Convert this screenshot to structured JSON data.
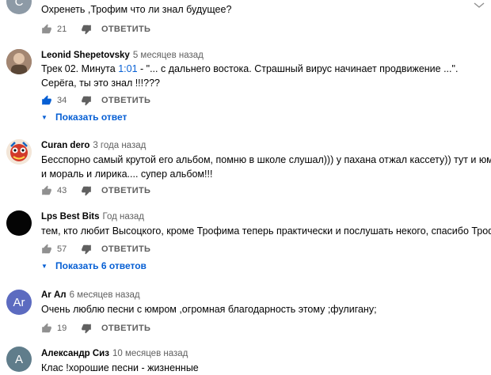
{
  "comments": [
    {
      "avatar_letter": "С",
      "avatar_color": "#8d9aa6",
      "author": "",
      "time": "",
      "lines": [
        "Охренеть ,Трофим что ли знал будущее?"
      ],
      "likes": "21",
      "reply_label": "ОТВЕТИТЬ"
    },
    {
      "avatar_color": "#8b6d5a",
      "author": "Leonid Shepetovsky",
      "time": "5 месяцев назад",
      "line1_prefix": "Трек 02. Минута ",
      "line1_link": "1:01",
      "line1_suffix": " - \"... с дальнего востока. Страшный вирус начинает продвижение ...\".",
      "line2": "Серёга, ты это знал !!!???",
      "likes": "34",
      "reply_label": "ОТВЕТИТЬ",
      "show_replies": "Показать ответ"
    },
    {
      "avatar_color": "#c0392b",
      "author": "Curan dero",
      "time": "3 года назад",
      "lines": [
        "Бесспорно самый крутой его альбом, помню в школе слушал))) у пахана отжал кассету)) тут и юмор",
        "и мораль и лирика.... супер альбом!!!"
      ],
      "likes": "43",
      "reply_label": "ОТВЕТИТЬ"
    },
    {
      "avatar_color": "#050505",
      "author": "Lps Best Bits",
      "time": "Год назад",
      "lines": [
        "тем, кто любит Высоцкого, кроме Трофима теперь практически и послушать некого, спасибо Трофим."
      ],
      "likes": "57",
      "reply_label": "ОТВЕТИТЬ",
      "show_replies": "Показать 6 ответов"
    },
    {
      "avatar_letter": "Ar",
      "avatar_color": "#5c6bc0",
      "author": "Ar Ал",
      "time": "6 месяцев назад",
      "lines": [
        "Очень люблю песни с юмром ,огромная благодарность этому ;фулигану;"
      ],
      "likes": "19",
      "reply_label": "ОТВЕТИТЬ"
    },
    {
      "avatar_letter": "А",
      "avatar_color": "#607d8b",
      "author": "Александр Сиз",
      "time": "10 месяцев назад",
      "lines": [
        "Клас !хорошие песни - жизненные"
      ]
    }
  ]
}
